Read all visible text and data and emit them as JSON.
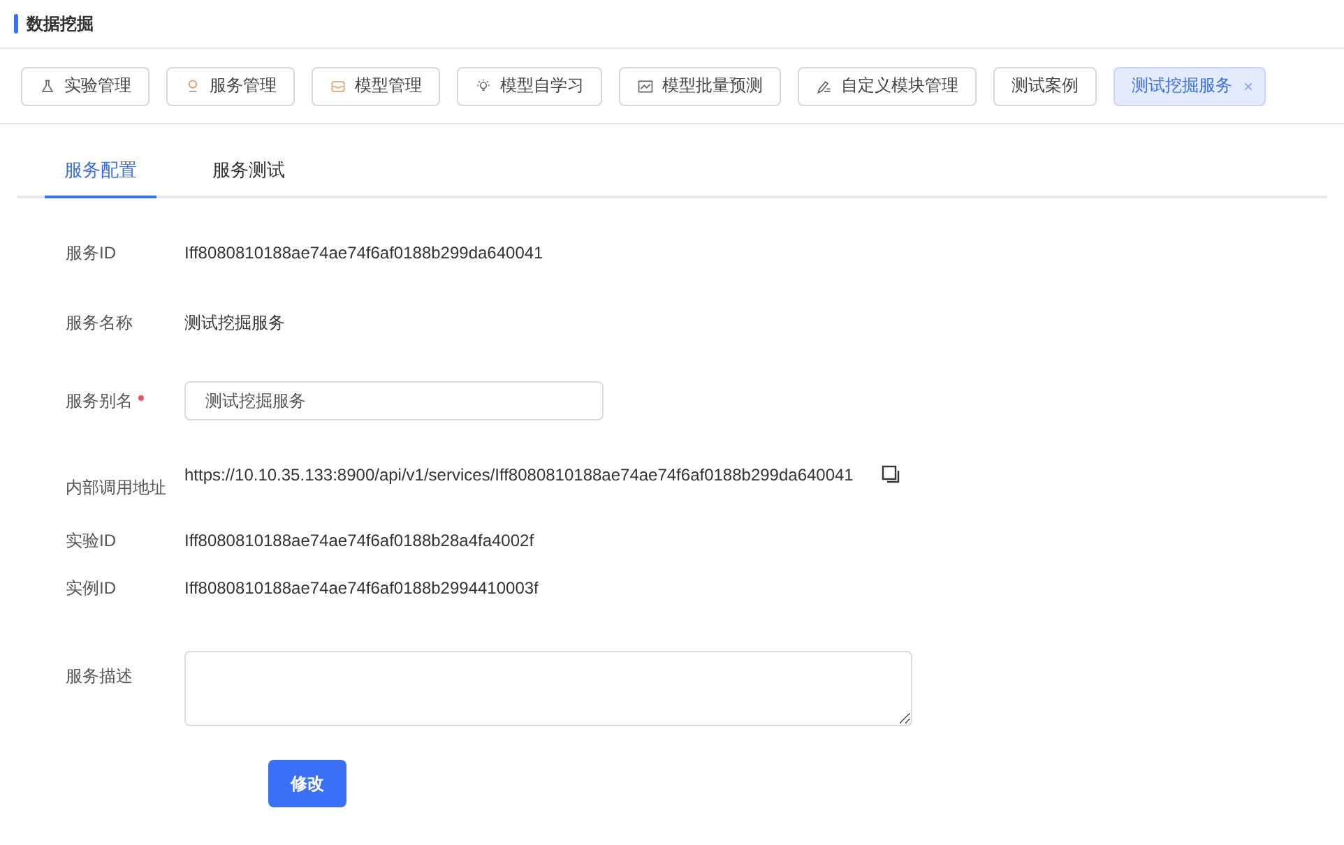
{
  "page_title": "数据挖掘",
  "tags": [
    {
      "label": "实验管理",
      "kind": "flask",
      "selected": false
    },
    {
      "label": "服务管理",
      "kind": "pin",
      "selected": false
    },
    {
      "label": "模型管理",
      "kind": "box",
      "selected": false
    },
    {
      "label": "模型自学习",
      "kind": "bulb",
      "selected": false
    },
    {
      "label": "模型批量预测",
      "kind": "chart",
      "selected": false
    },
    {
      "label": "自定义模块管理",
      "kind": "pen",
      "selected": false
    },
    {
      "label": "测试案例",
      "kind": "none",
      "selected": false
    },
    {
      "label": "测试挖掘服务",
      "kind": "none",
      "selected": true,
      "close": "×"
    }
  ],
  "tabs": [
    {
      "label": "服务配置",
      "selected": true
    },
    {
      "label": "服务测试",
      "selected": false
    }
  ],
  "fields": [
    {
      "kind": "text",
      "label": "服务ID",
      "value": "Iff8080810188ae74ae74f6af0188b299da640041"
    },
    {
      "kind": "text",
      "label": "服务名称",
      "value": "测试挖掘服务"
    },
    {
      "kind": "input",
      "label": "服务别名",
      "required": true,
      "value": "测试挖掘服务"
    },
    {
      "kind": "copy",
      "label": "内部调用地址",
      "value": "https://10.10.35.133:8900/api/v1/services/Iff8080810188ae74ae74f6af0188b299da640041"
    },
    {
      "kind": "text",
      "label": "实验ID",
      "value": "Iff8080810188ae74ae74f6af0188b28a4fa4002f"
    },
    {
      "kind": "text",
      "label": "实例ID",
      "value": "Iff8080810188ae74ae74f6af0188b2994410003f"
    },
    {
      "kind": "textarea",
      "label": "服务描述"
    }
  ],
  "submit": "修改"
}
